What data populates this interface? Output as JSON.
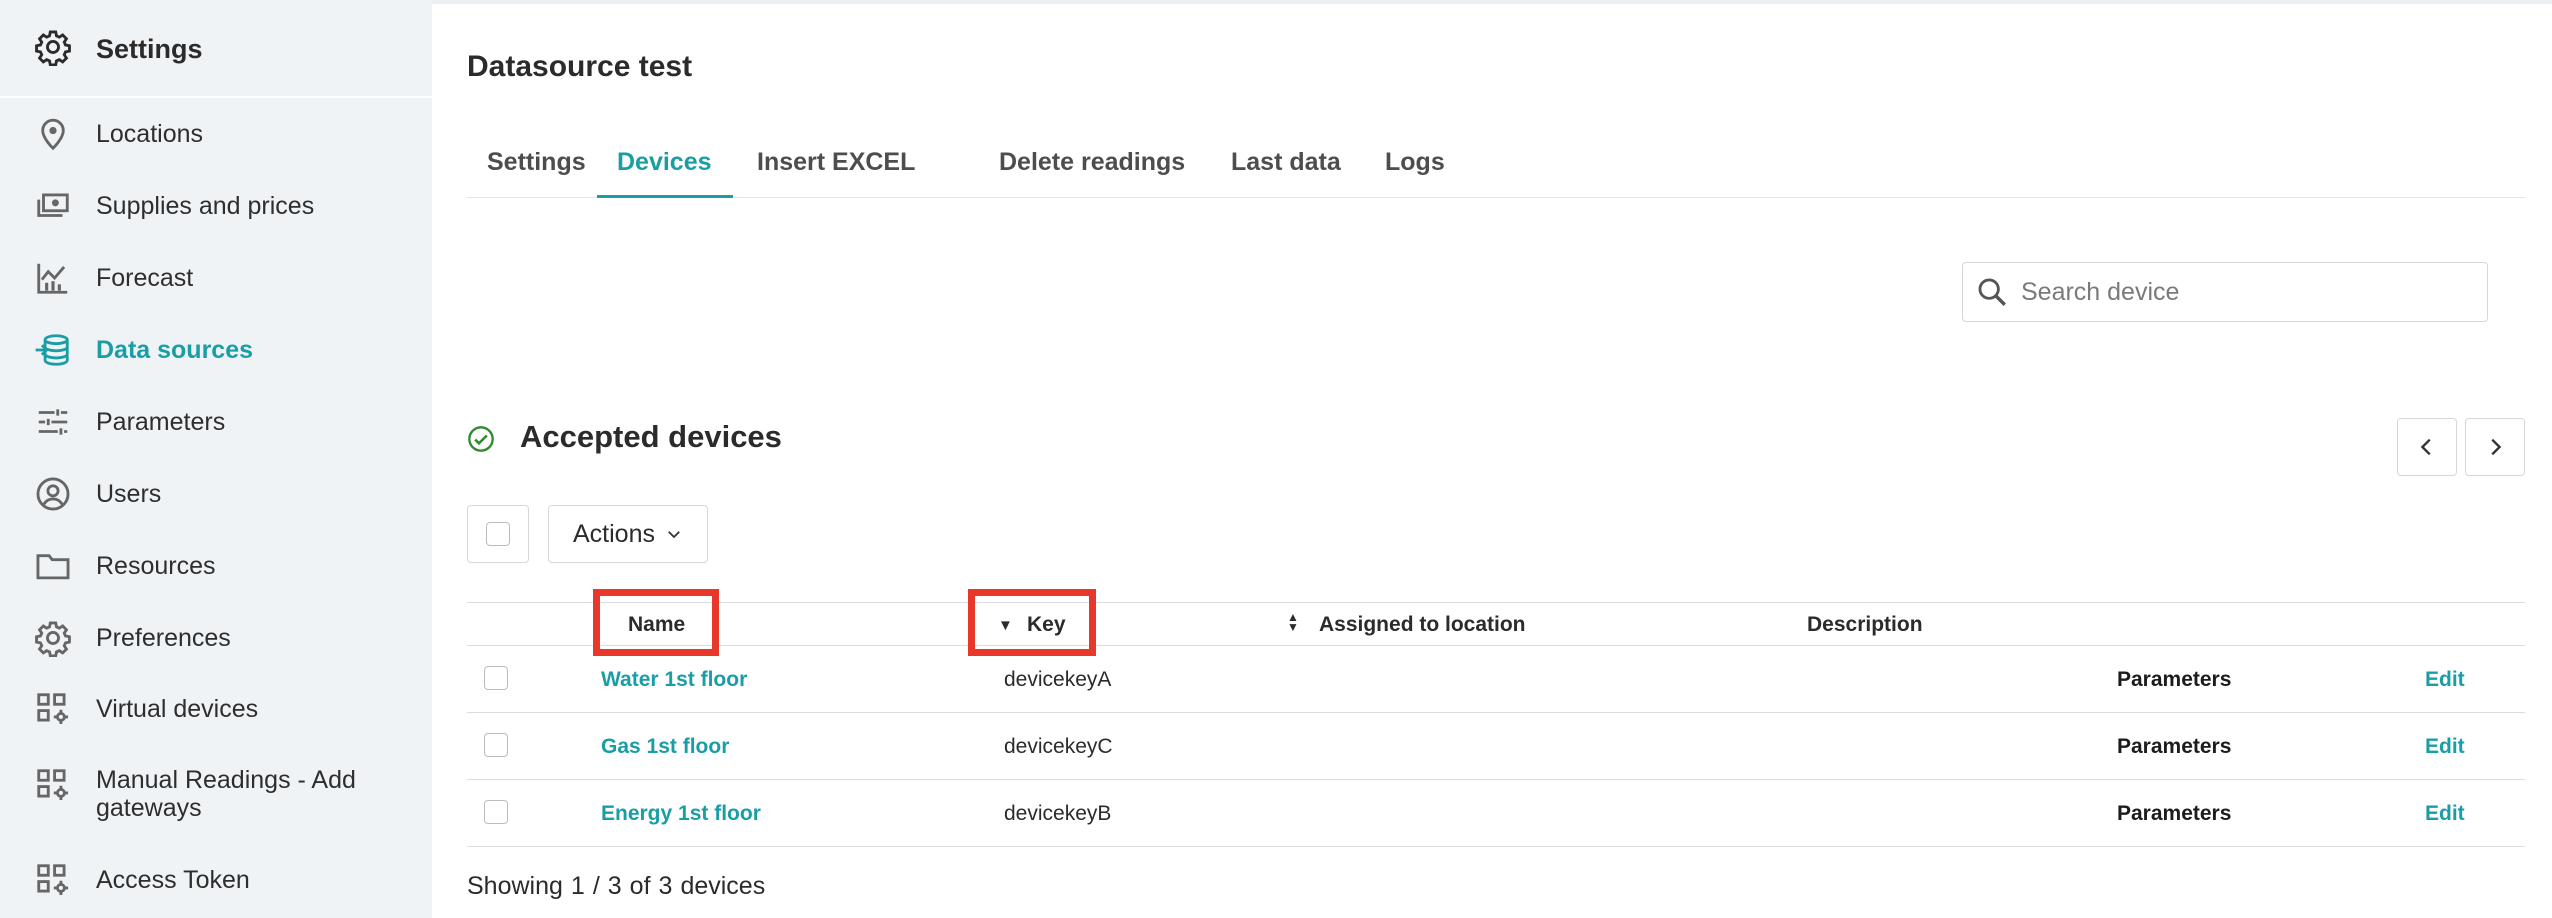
{
  "sidebar": {
    "header": {
      "title": "Settings",
      "icon": "gear-icon"
    },
    "items": [
      {
        "label": "Locations",
        "icon": "location-pin-icon",
        "active": false
      },
      {
        "label": "Supplies and prices",
        "icon": "money-icon",
        "active": false
      },
      {
        "label": "Forecast",
        "icon": "chart-icon",
        "active": false
      },
      {
        "label": "Data sources",
        "icon": "database-icon",
        "active": true
      },
      {
        "label": "Parameters",
        "icon": "sliders-icon",
        "active": false
      },
      {
        "label": "Users",
        "icon": "user-circle-icon",
        "active": false
      },
      {
        "label": "Resources",
        "icon": "folder-icon",
        "active": false
      },
      {
        "label": "Preferences",
        "icon": "gear-icon",
        "active": false
      },
      {
        "label": "Virtual devices",
        "icon": "grid-gear-icon",
        "active": false
      },
      {
        "label": "Manual Readings - Add gateways",
        "icon": "grid-gear-icon",
        "active": false
      },
      {
        "label": "Access Token",
        "icon": "grid-gear-icon",
        "active": false
      }
    ]
  },
  "page": {
    "title": "Datasource test"
  },
  "tabs": [
    {
      "label": "Settings",
      "active": false
    },
    {
      "label": "Devices",
      "active": true
    },
    {
      "label": "Insert EXCEL",
      "active": false
    },
    {
      "label": "Delete readings",
      "active": false
    },
    {
      "label": "Last data",
      "active": false
    },
    {
      "label": "Logs",
      "active": false
    }
  ],
  "search": {
    "placeholder": "Search device",
    "value": ""
  },
  "section": {
    "title": "Accepted devices",
    "icon": "check-circle-icon"
  },
  "toolbar": {
    "actions_label": "Actions"
  },
  "table": {
    "columns": [
      "Name",
      "Key",
      "Assigned to location",
      "Description"
    ],
    "rows": [
      {
        "name": "Water 1st floor",
        "key": "devicekeyA",
        "location": "",
        "description": "",
        "params_label": "Parameters",
        "edit_label": "Edit"
      },
      {
        "name": "Gas 1st floor",
        "key": "devicekeyC",
        "location": "",
        "description": "",
        "params_label": "Parameters",
        "edit_label": "Edit"
      },
      {
        "name": "Energy 1st floor",
        "key": "devicekeyB",
        "location": "",
        "description": "",
        "params_label": "Parameters",
        "edit_label": "Edit"
      }
    ]
  },
  "footer": {
    "prefix": "Showing",
    "from": "1",
    "sep": "/",
    "to": "3",
    "of": "of",
    "total": "3",
    "suffix": "devices"
  },
  "colors": {
    "accent": "#1a9ea5",
    "highlight": "#e8382b",
    "sidebar_bg": "#f0f3f6",
    "success": "#2e8b2e"
  }
}
